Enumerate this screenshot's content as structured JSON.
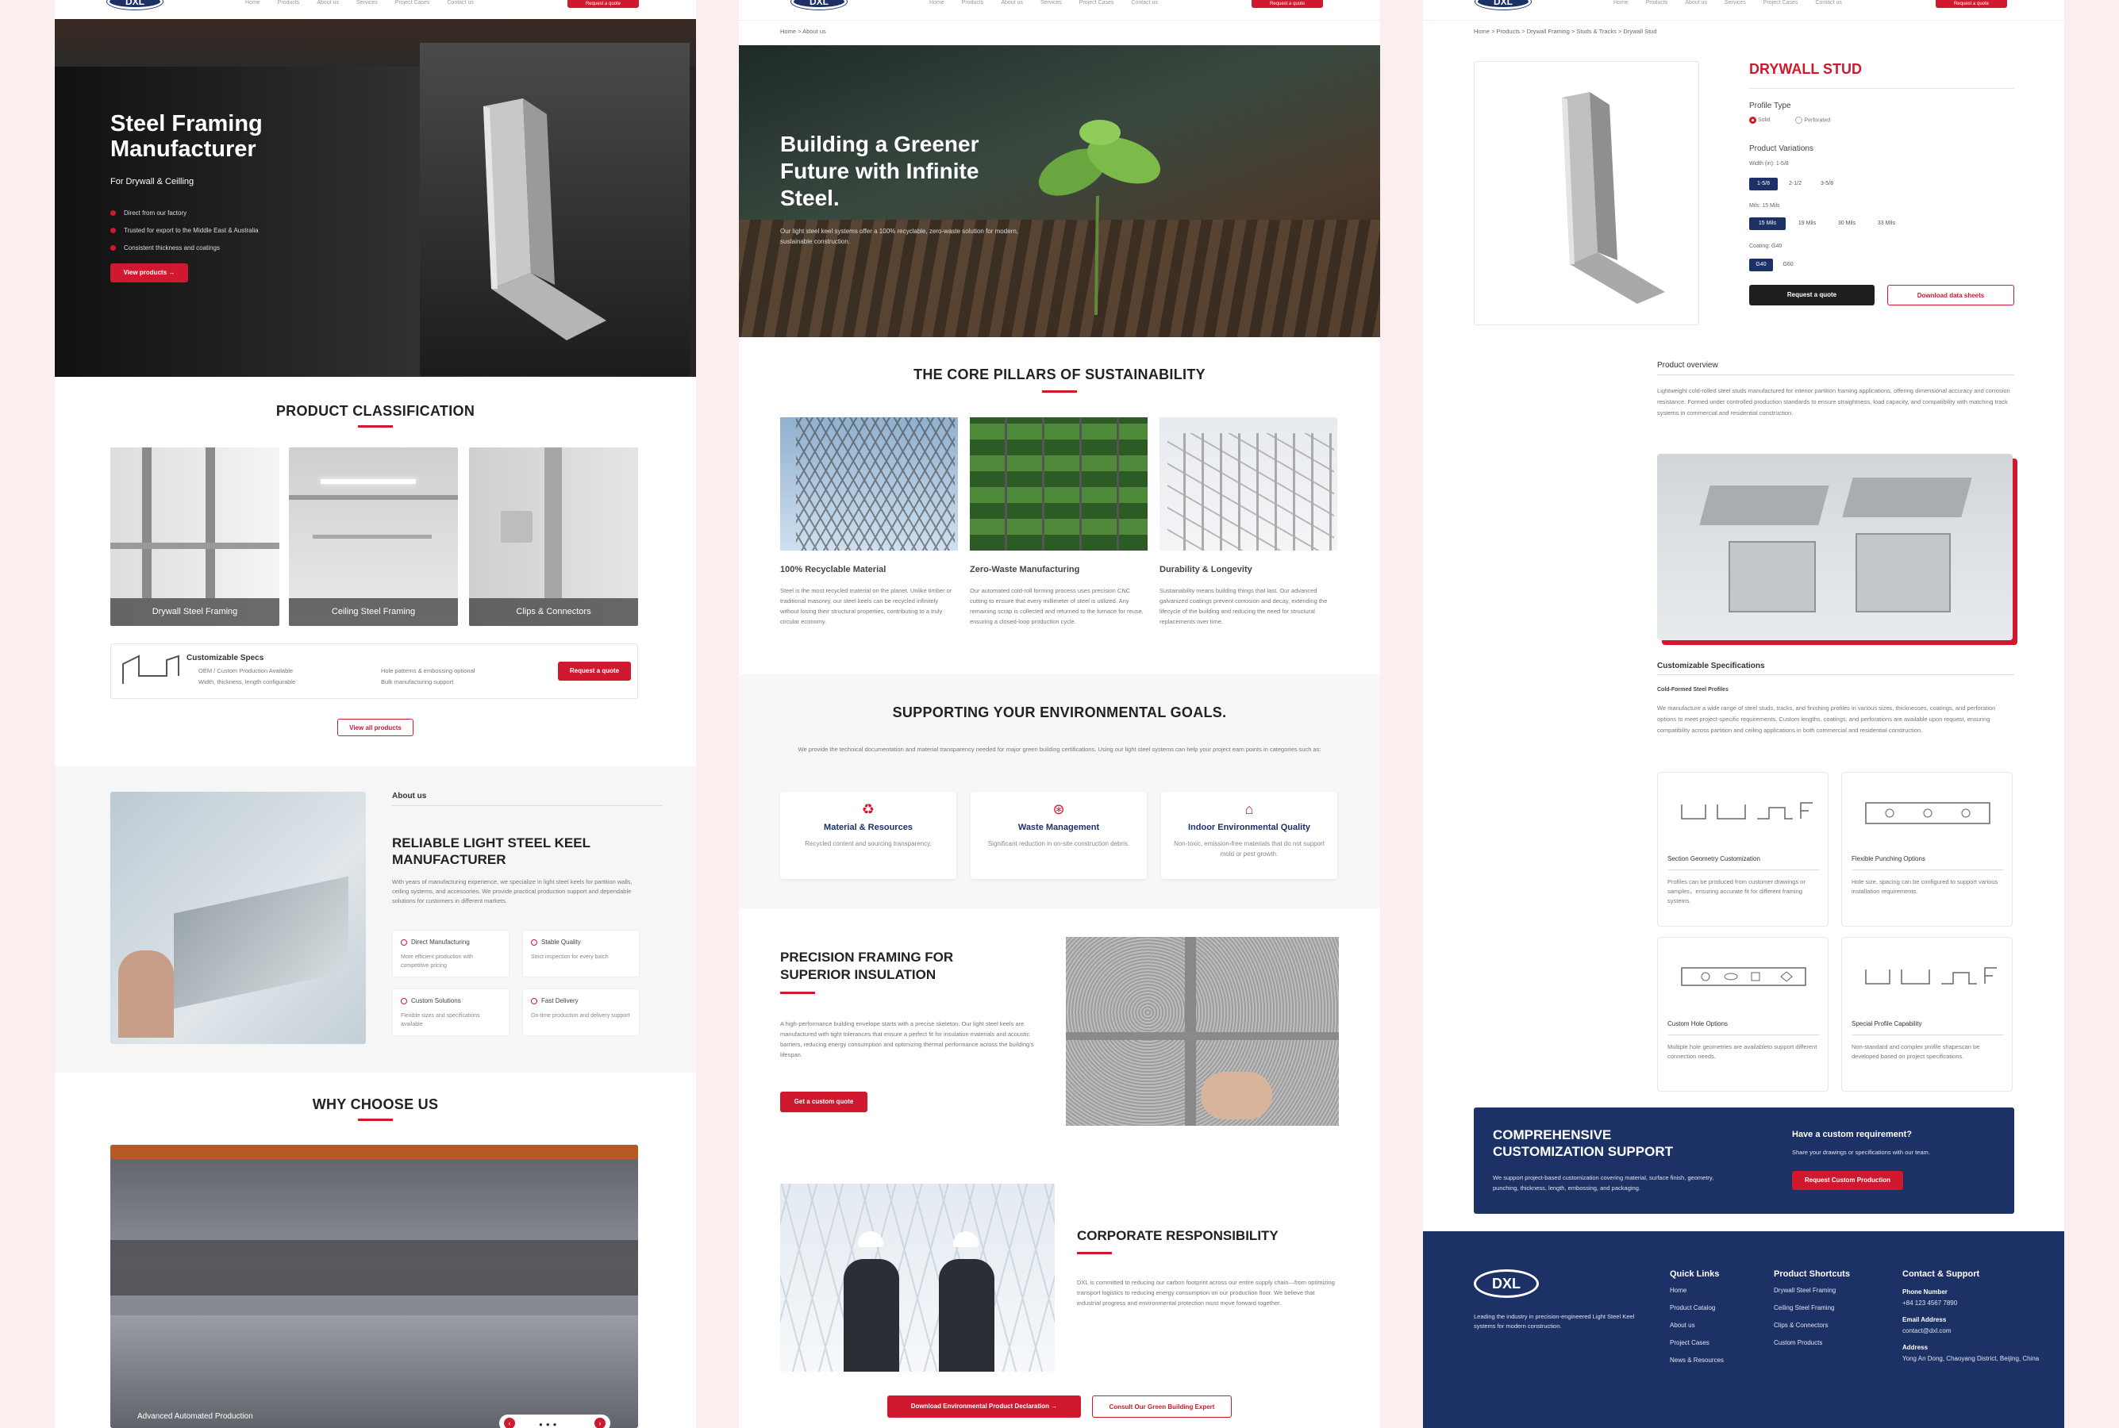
{
  "nav": {
    "links": [
      "Home",
      "Products",
      "About us",
      "Services",
      "Project Cases",
      "Contact us"
    ],
    "cta": "Request a quote"
  },
  "home": {
    "hero": {
      "title": "Steel Framing Manufacturer",
      "subtitle": "For Drywall & Ceilling",
      "bullets": [
        "Direct from our factory",
        "Trusted for export to the Middle East & Australia",
        "Consistent thickness and coatings"
      ],
      "button": "View products"
    },
    "classification": {
      "title": "PRODUCT CLASSIFICATION",
      "cards": [
        "Drywall Steel Framing",
        "Ceiling Steel Framing",
        "Clips & Connectors"
      ]
    },
    "specs": {
      "title": "Customizable Specs",
      "items": [
        "OEM / Custom Production Available",
        "Width, thickness, length configurable",
        "Hole patterns & embossing optional",
        "Bulk manufacturing support"
      ],
      "button": "Request a quote"
    },
    "view_all": "View all products",
    "about": {
      "eyebrow": "About us",
      "title": "RELIABLE LIGHT STEEL KEEL MANUFACTURER",
      "body": "With years of manufacturing experience, we specialize in light steel keels for partition walls, ceiling systems, and accessories. We provide practical production support and dependable solutions for customers in different markets.",
      "features": [
        {
          "title": "Direct Manufacturing",
          "desc": "More efficient production with competitive pricing"
        },
        {
          "title": "Stable Quality",
          "desc": "Strict inspection for every batch"
        },
        {
          "title": "Custom Solutions",
          "desc": "Flexible sizes and specifications available"
        },
        {
          "title": "Fast Delivery",
          "desc": "On-time production and delivery support"
        }
      ]
    },
    "why": {
      "title": "WHY CHOOSE US",
      "caption": "Advanced Automated Production"
    }
  },
  "about_page": {
    "breadcrumb": "Home > About us",
    "hero": {
      "title": "Building a Greener Future with Infinite Steel.",
      "body": "Our light steel keel systems offer a 100% recyclable, zero-waste solution for modern, sustainable construction."
    },
    "pillars": {
      "title": "THE CORE PILLARS OF SUSTAINABILITY",
      "items": [
        {
          "title": "100% Recyclable Material",
          "body": "Steel is the most recycled material on the planet. Unlike timber or traditional masonry, our steel keels can be recycled infinitely without losing their structural properties, contributing to a truly circular economy."
        },
        {
          "title": "Zero-Waste Manufacturing",
          "body": "Our automated cold-roll forming process uses precision CNC cutting to ensure that every millimeter of steel is utilized. Any remaining scrap is collected and returned to the furnace for reuse, ensuring a closed-loop production cycle."
        },
        {
          "title": "Durability & Longevity",
          "body": "Sustainability means building things that last. Our advanced galvanized coatings prevent corrosion and decay, extending the lifecycle of the building and reducing the need for structural replacements over time."
        }
      ]
    },
    "goals": {
      "title": "SUPPORTING YOUR ENVIRONMENTAL GOALS.",
      "intro": "We provide the technical documentation and material transparency needed for major green building certifications. Using our light steel systems can help your project earn points in categories such as:",
      "items": [
        {
          "title": "Material & Resources",
          "desc": "Recycled content and sourcing transparency."
        },
        {
          "title": "Waste Management",
          "desc": "Significant reduction in on-site construction debris."
        },
        {
          "title": "Indoor Environmental Quality",
          "desc": "Non-toxic, emission-free materials that do not support mold or pest growth."
        }
      ]
    },
    "precision": {
      "title": "PRECISION FRAMING FOR SUPERIOR INSULATION",
      "body": "A high-performance building envelope starts with a precise skeleton. Our light steel keels are manufactured with tight tolerances that ensure a perfect fit for insulation materials and acoustic barriers, reducing energy consumption and optimizing thermal performance across the building's lifespan.",
      "button": "Get a custom quote"
    },
    "corporate": {
      "title": "CORPORATE RESPONSIBILITY",
      "body": "DXL is committed to reducing our carbon footprint across our entire supply chain—from optimizing transport logistics to reducing energy consumption on our production floor. We believe that industrial progress and environmental protection must move forward together."
    },
    "buttons": {
      "download": "Download Environmental Product Declaration",
      "consult": "Consult Our Green Building Expert"
    }
  },
  "product": {
    "breadcrumb": "Home > Products > Drywall Framing > Studs & Tracks > Drywall Stud",
    "title": "DRYWALL STUD",
    "profile_label": "Profile Type",
    "profile_options": [
      "Solid",
      "Perforated"
    ],
    "variations_label": "Product Variations",
    "width_label": "Width (in): 1-5/8",
    "widths": [
      "1-5/8",
      "2-1/2",
      "3-5/8"
    ],
    "mils_label": "Mils: 15 Mils",
    "mils": [
      "15 Mils",
      "19 Mils",
      "30 Mils",
      "33 Mils"
    ],
    "coating_label": "Coating: G40",
    "coatings": [
      "G40",
      "G60"
    ],
    "request_btn": "Request a quote",
    "datasheet_btn": "Download data sheets",
    "overview_title": "Product overview",
    "overview_body": "Lightweight cold-rolled steel studs manufactured for interior partition framing applications, offering dimensional accuracy and corrosion resistance. Formed under controlled production standards to ensure straightness, load capacity, and compatibility with matching track systems in commercial and residential construction.",
    "custom_title": "Customizable Specifications",
    "custom_sub": "Cold-Formed Steel Profiles",
    "custom_body": "We manufacture a wide range of steel studs, tracks, and finishing profiles in various sizes, thicknesses, coatings, and perforation options to meet project-specific requirements. Custom lengths, coatings, and perforations are available upon request, ensuring compatibility across partition and ceiling applications in both commercial and residential construction.",
    "spec_cards": [
      {
        "title": "Section Geometry Customization",
        "desc": "Profiles can be produced from customer drawings or samples，ensuring accurate fit for different framing systems."
      },
      {
        "title": "Flexible Punching Options",
        "desc": "Hole size, spacing can be configured to support various installation requirements."
      },
      {
        "title": "Custom Hole Options",
        "desc": "Multiple hole geometries are availableto support different connection needs."
      },
      {
        "title": "Special Profile Capability",
        "desc": "Non-standard and complex profile shapescan be developed based on project specifications."
      }
    ],
    "banner": {
      "title": "COMPREHENSIVE CUSTOMIZATION SUPPORT",
      "body": "We support project-based customization covering material, surface finish, geometry, punching, thickness, length, embossing, and packaging.",
      "q": "Have a custom requirement?",
      "q_sub": "Share your drawings or specifications with our team.",
      "button": "Request Custom Production"
    },
    "footer": {
      "logo": "DXL",
      "tagline": "Leading the industry in precision-engineered Light Steel Keel systems for modern construction.",
      "quick_title": "Quick Links",
      "quick": [
        "Home",
        "Product Catalog",
        "About us",
        "Project Cases",
        "News & Resources"
      ],
      "shortcuts_title": "Product Shortcuts",
      "shortcuts": [
        "Drywall Steel Framing",
        "Ceiling Steel Framing",
        "Clips & Connectors",
        "Custom Products"
      ],
      "contact_title": "Contact & Support",
      "phone_label": "Phone Number",
      "phone": "+84 123 4567 7890",
      "email_label": "Email Address",
      "email": "contact@dxl.com",
      "address_label": "Address",
      "address": "Yong An Dong, Chaoyang District, Beijing, China"
    }
  },
  "colors": {
    "accent": "#d0192f",
    "navy": "#1c3166"
  }
}
